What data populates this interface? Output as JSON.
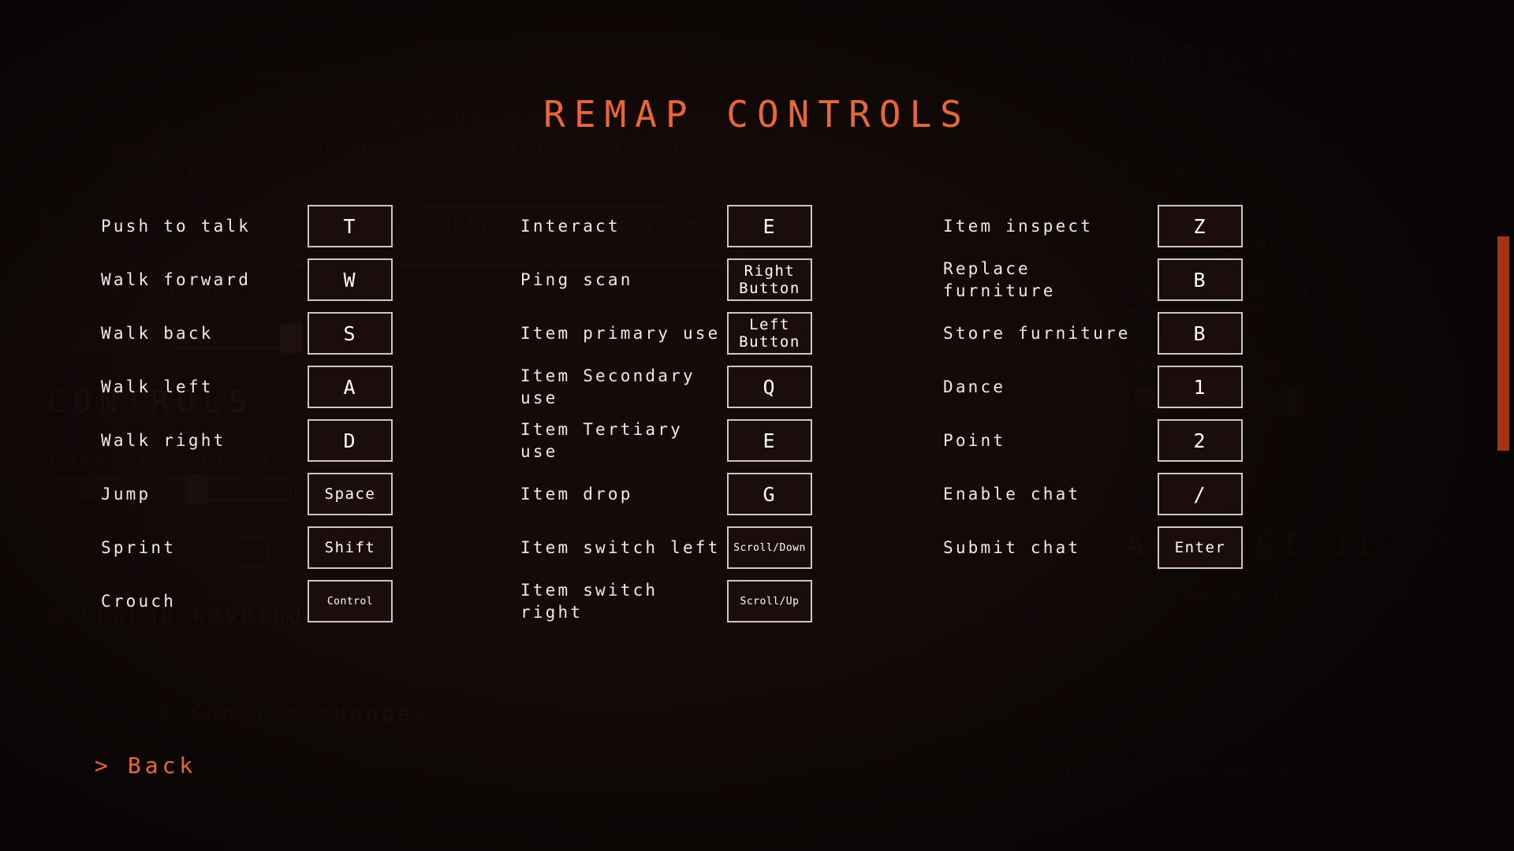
{
  "title": "REMAP CONTROLS",
  "back": {
    "chevron": ">",
    "label": "Back"
  },
  "columns": [
    {
      "id": "movement",
      "rows": [
        {
          "label": "Push to talk",
          "key": "T",
          "size": "large"
        },
        {
          "label": "Walk forward",
          "key": "W",
          "size": "large"
        },
        {
          "label": "Walk back",
          "key": "S",
          "size": "large"
        },
        {
          "label": "Walk left",
          "key": "A",
          "size": "large"
        },
        {
          "label": "Walk right",
          "key": "D",
          "size": "large"
        },
        {
          "label": "Jump",
          "key": "Space",
          "size": "med"
        },
        {
          "label": "Sprint",
          "key": "Shift",
          "size": "med"
        },
        {
          "label": "Crouch",
          "key": "Control",
          "size": "small"
        }
      ]
    },
    {
      "id": "interaction",
      "rows": [
        {
          "label": "Interact",
          "key": "E",
          "size": "large"
        },
        {
          "label": "Ping scan",
          "key": "Right\nButton",
          "size": "med"
        },
        {
          "label": "Item primary use",
          "key": "Left\nButton",
          "size": "med"
        },
        {
          "label": "Item Secondary use",
          "key": "Q",
          "size": "large"
        },
        {
          "label": "Item Tertiary use",
          "key": "E",
          "size": "large"
        },
        {
          "label": "Item drop",
          "key": "G",
          "size": "large"
        },
        {
          "label": "Item switch left",
          "key": "Scroll/Down",
          "size": "small"
        },
        {
          "label": "Item switch right",
          "key": "Scroll/Up",
          "size": "small"
        }
      ]
    },
    {
      "id": "social",
      "rows": [
        {
          "label": "Item inspect",
          "key": "Z",
          "size": "large"
        },
        {
          "label": "Replace furniture",
          "key": "B",
          "size": "large"
        },
        {
          "label": "Store furniture",
          "key": "B",
          "size": "large"
        },
        {
          "label": "Dance",
          "key": "1",
          "size": "large"
        },
        {
          "label": "Point",
          "key": "2",
          "size": "large"
        },
        {
          "label": "Enable chat",
          "key": "/",
          "size": "large"
        },
        {
          "label": "Submit chat",
          "key": "Enter",
          "size": "med"
        }
      ]
    }
  ],
  "background": {
    "input_device_label": "Current input device:",
    "input_device_value": "Microphone (SteelSeries Arctis 7",
    "mic_mode": "MODE: Voice Activation",
    "controls_heading": "CONTROLS",
    "master_volume_label": "Master volume:",
    "look_sensitivity_label": "Look sensitivity:",
    "invert_axis_label": "Invert axis",
    "change_keybinds": "> Change keybinds",
    "confirm_changes": "> Confirm changes",
    "display_heading": "DISPLAY",
    "frame_rate_label": "Frame rate cap:",
    "frame_rate_value": "120 FPS",
    "display_mode_label": "Display mode:",
    "display_mode_value": "Windowed fullscreen",
    "gamma_label": "Gamma/Brightness:",
    "accessibility_heading": "ACCESSIBILITY",
    "arachnophobia_label": "Arachnophobia mode",
    "reset_defaults": "> Reset all to defaults"
  },
  "colors": {
    "accent": "#e8673a",
    "key_border": "#cdc6c4",
    "label": "#efeae8",
    "background": "#0d0706",
    "scrollbar": "#a83312"
  }
}
